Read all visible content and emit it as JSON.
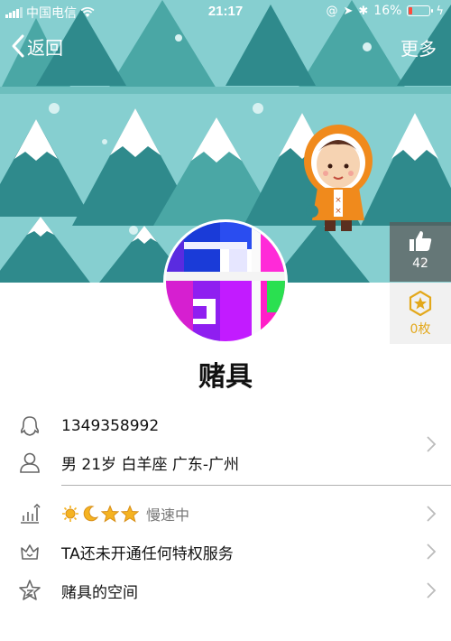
{
  "status_bar": {
    "carrier": "中国电信",
    "time": "21:17",
    "battery": "16%"
  },
  "nav": {
    "back_label": "返回",
    "more_label": "更多"
  },
  "like": {
    "count": "42"
  },
  "coins": {
    "count": "0枚"
  },
  "profile": {
    "name": "赌具",
    "qq_number": "1349358992",
    "info": "男 21岁 白羊座 广东-广州",
    "level_status": "慢速中",
    "privilege": "TA还未开通任何特权服务",
    "space": "赌具的空间"
  },
  "colors": {
    "banner_bg": "#86cfd0",
    "tree_dark": "#2f8a8c",
    "tree_mid": "#4aa7a5",
    "coin_gold": "#e3a81b"
  },
  "icons": [
    "signal-icon",
    "wifi-icon",
    "battery-icon",
    "back-chevron-icon",
    "thumbs-up-icon",
    "star-coin-icon",
    "penguin-icon",
    "person-icon",
    "level-chart-icon",
    "crown-icon",
    "star-space-icon",
    "chevron-right-icon",
    "sun-icon",
    "moon-icon",
    "star-icon"
  ]
}
